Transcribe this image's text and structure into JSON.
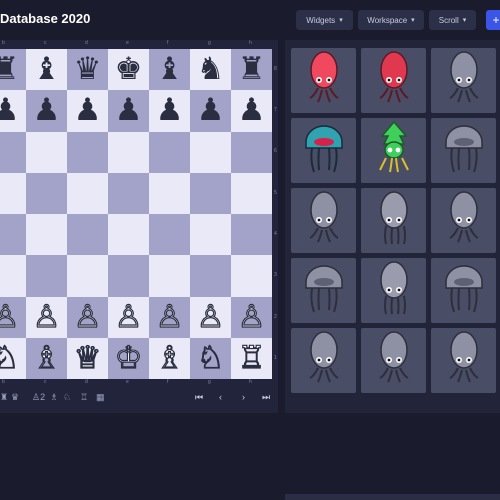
{
  "header": {
    "title": "Database 2020",
    "widgets_label": "Widgets",
    "workspace_label": "Workspace",
    "scroll_label": "Scroll",
    "add_label": "+"
  },
  "board": {
    "files": [
      "b",
      "c",
      "d",
      "e",
      "f",
      "g",
      "h"
    ],
    "ranks": [
      "8",
      "7",
      "6",
      "5",
      "4",
      "3",
      "2",
      "1"
    ],
    "rows": [
      [
        "♜",
        "♝",
        "♛",
        "♚",
        "♝",
        "♞",
        "♜"
      ],
      [
        "♟",
        "♟",
        "♟",
        "♟",
        "♟",
        "♟",
        "♟"
      ],
      [
        "",
        "",
        "",
        "",
        "",
        "",
        ""
      ],
      [
        "",
        "",
        "",
        "",
        "",
        "",
        ""
      ],
      [
        "",
        "",
        "",
        "",
        "",
        "",
        ""
      ],
      [
        "",
        "",
        "",
        "",
        "",
        "",
        ""
      ],
      [
        "♙",
        "♙",
        "♙",
        "♙",
        "♙",
        "♙",
        "♙"
      ],
      [
        "♘",
        "♗",
        "♕",
        "♔",
        "♗",
        "♘",
        "♖"
      ]
    ],
    "row_colors": [
      "black",
      "black",
      "",
      "",
      "",
      "",
      "white",
      "white"
    ]
  },
  "controls": {
    "material_count": "2",
    "nav": [
      "⏮",
      "‹",
      "›",
      "⏭"
    ]
  },
  "creature_grid": [
    [
      "squid-red",
      "squid-red-dark",
      "squid-gray"
    ],
    [
      "jellyfish-blue",
      "squid-green",
      "jellyfish-gray"
    ],
    [
      "squid-gray",
      "squid-gray-tentacle",
      "squid-gray"
    ],
    [
      "jellyfish-gray",
      "squid-gray-tentacle",
      "jellyfish-gray"
    ],
    [
      "squid-gray",
      "squid-gray",
      "squid-gray"
    ]
  ],
  "colors": {
    "background": "#1a1c2e",
    "accent": "#3b55e6",
    "light_square": "#e9e9f7",
    "dark_square": "#a3a3c9"
  }
}
